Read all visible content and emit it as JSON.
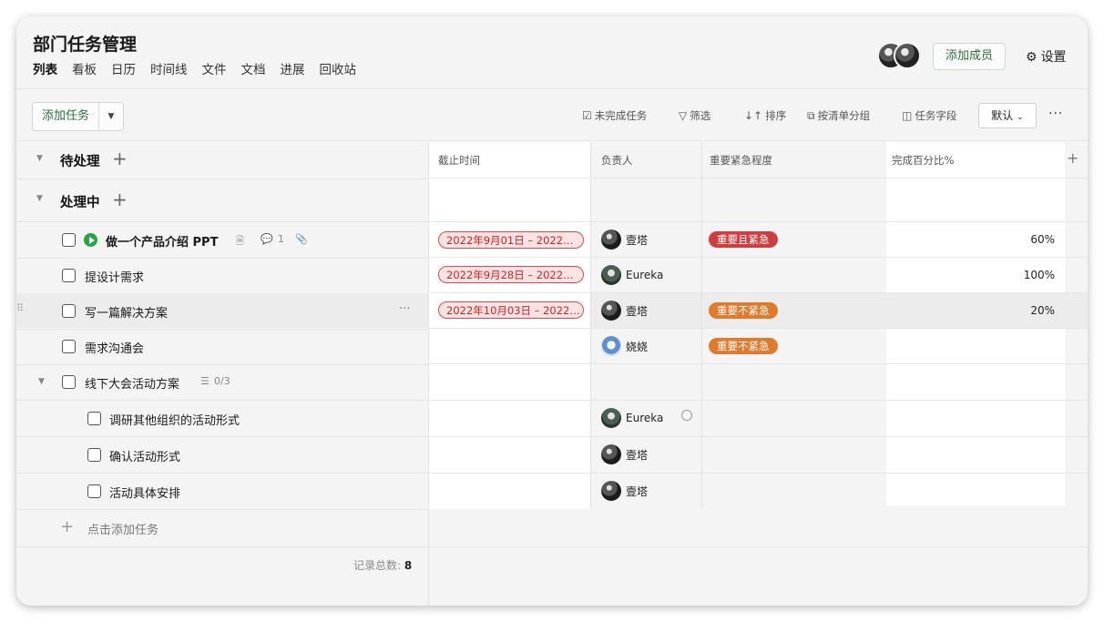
{
  "header": {
    "title": "部门任务管理",
    "nav": [
      "列表",
      "看板",
      "日历",
      "时间线",
      "文件",
      "文档",
      "进展",
      "回收站"
    ],
    "add_member_label": "添加成员",
    "settings_label": "设置"
  },
  "toolbar": {
    "add_task_label": "添加任务",
    "incomplete_label": "未完成任务",
    "filter_label": "筛选",
    "sort_label": "排序",
    "group_label": "按清单分组",
    "fields_label": "任务字段",
    "default_label": "默认",
    "more_label": "···"
  },
  "columns": {
    "deadline": "截止时间",
    "assignee": "负责人",
    "priority": "重要紧急程度",
    "progress": "完成百分比%"
  },
  "groups": [
    {
      "name": "待处理"
    },
    {
      "name": "处理中"
    }
  ],
  "tasks": [
    {
      "name": "做一个产品介绍 PPT",
      "comments": "1",
      "deadline": "2022年9月01日 – 2022…",
      "assignee": "壹塔",
      "priority": "重要且紧急",
      "progress": "60%"
    },
    {
      "name": "提设计需求",
      "deadline": "2022年9月28日 – 2022…",
      "assignee": "Eureka",
      "priority": "",
      "progress": "100%"
    },
    {
      "name": "写一篇解决方案",
      "deadline": "2022年10月03日 – 2022…",
      "assignee": "壹塔",
      "priority": "重要不紧急",
      "progress": "20%"
    },
    {
      "name": "需求沟通会",
      "deadline": "",
      "assignee": "娆娆",
      "priority": "重要不紧急",
      "progress": ""
    },
    {
      "name": "线下大会活动方案",
      "subtask_count": "0/3",
      "deadline": "",
      "assignee": "",
      "priority": "",
      "progress": ""
    },
    {
      "name": "调研其他组织的活动形式",
      "deadline": "",
      "assignee": "Eureka",
      "priority": "",
      "progress": ""
    },
    {
      "name": "确认活动形式",
      "deadline": "",
      "assignee": "壹塔",
      "priority": "",
      "progress": ""
    },
    {
      "name": "活动具体安排",
      "deadline": "",
      "assignee": "壹塔",
      "priority": "",
      "progress": ""
    }
  ],
  "footer": {
    "add_task_label": "点击添加任务",
    "total_label": "记录总数:",
    "total_value": "8"
  },
  "colors": {
    "accent_green": "#2f6f3f",
    "play_green": "#22a447",
    "priority_urgent": "#d03d3d",
    "priority_important": "#e07a2c",
    "deadline_red": "#d84a4a"
  }
}
